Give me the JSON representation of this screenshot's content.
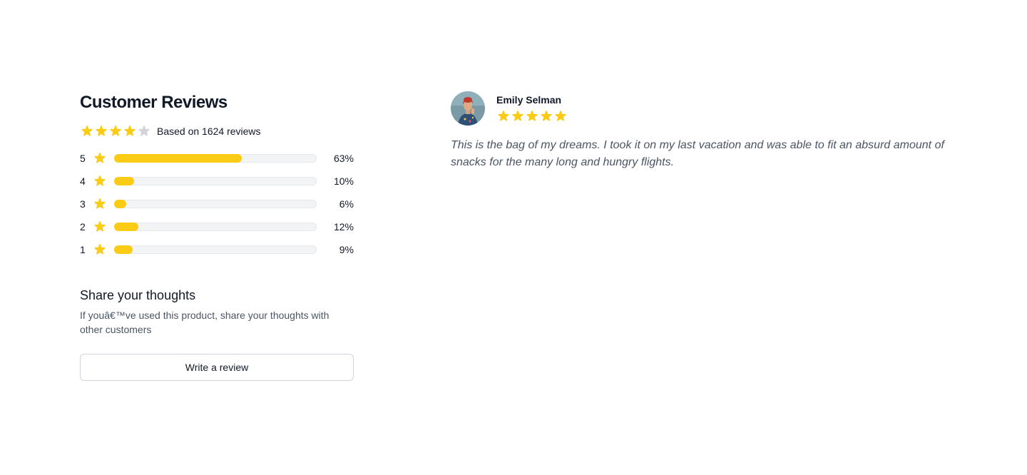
{
  "summary": {
    "heading": "Customer Reviews",
    "average_rating": 4,
    "max_rating": 5,
    "based_on": "Based on 1624 reviews",
    "star_color": "#facc15",
    "empty_star_color": "#d1d5db"
  },
  "distribution": [
    {
      "stars": "5",
      "percent_label": "63%",
      "percent": 63
    },
    {
      "stars": "4",
      "percent_label": "10%",
      "percent": 10
    },
    {
      "stars": "3",
      "percent_label": "6%",
      "percent": 6
    },
    {
      "stars": "2",
      "percent_label": "12%",
      "percent": 12
    },
    {
      "stars": "1",
      "percent_label": "9%",
      "percent": 9
    }
  ],
  "share": {
    "title": "Share your thoughts",
    "text": "If youâ€™ve used this product, share your thoughts with other customers",
    "button_label": "Write a review"
  },
  "review": {
    "author": "Emily Selman",
    "rating": 5,
    "text": "This is the bag of my dreams. I took it on my last vacation and was able to fit an absurd amount of snacks for the many long and hungry flights.",
    "avatar_icon": "reviewer-avatar"
  }
}
